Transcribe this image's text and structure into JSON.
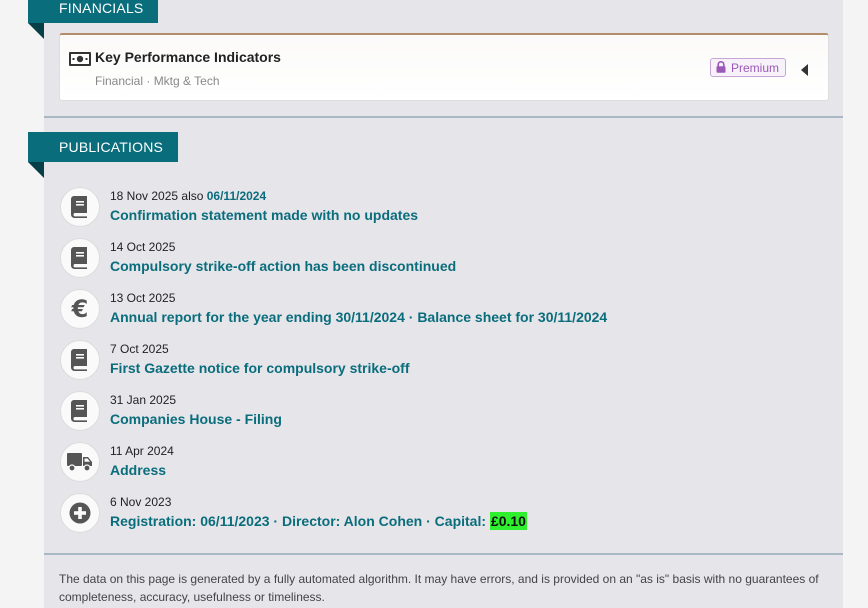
{
  "financials": {
    "section_label": "FINANCIALS",
    "card": {
      "icon": "money-icon",
      "title": "Key Performance Indicators",
      "subtitle": "Financial · Mktg & Tech",
      "badge_label": "Premium",
      "badge_color": "#9b59b6"
    }
  },
  "publications": {
    "section_label": "PUBLICATIONS",
    "items": [
      {
        "icon": "book-icon",
        "date": "18 Nov 2025",
        "also_prefix": " also ",
        "also_date": "06/11/2024",
        "title": "Confirmation statement made with no updates"
      },
      {
        "icon": "book-icon",
        "date": "14 Oct 2025",
        "title": "Compulsory strike-off action has been discontinued"
      },
      {
        "icon": "euro-icon",
        "date": "13 Oct 2025",
        "title": "Annual report for the year ending 30/11/2024 · Balance sheet for 30/11/2024"
      },
      {
        "icon": "book-icon",
        "date": "7 Oct 2025",
        "title": "First Gazette notice for compulsory strike-off"
      },
      {
        "icon": "book-icon",
        "date": "31 Jan 2025",
        "title": "Companies House - Filing"
      },
      {
        "icon": "truck-icon",
        "date": "11 Apr 2024",
        "title": "Address"
      },
      {
        "icon": "plus-circle-icon",
        "date": "6 Nov 2023",
        "title": "Registration: 06/11/2023 · Director: Alon Cohen · Capital: ",
        "highlight": "£0.10",
        "highlight_color": "#2ef02e"
      }
    ]
  },
  "disclaimer": "The data on this page is generated by a fully automated algorithm. It may have errors, and is provided on an \"as is\" basis with no guarantees of completeness, accuracy, usefulness or timeliness.",
  "colors": {
    "accent": "#0a6d7c",
    "panel": "#e6e5ea"
  }
}
